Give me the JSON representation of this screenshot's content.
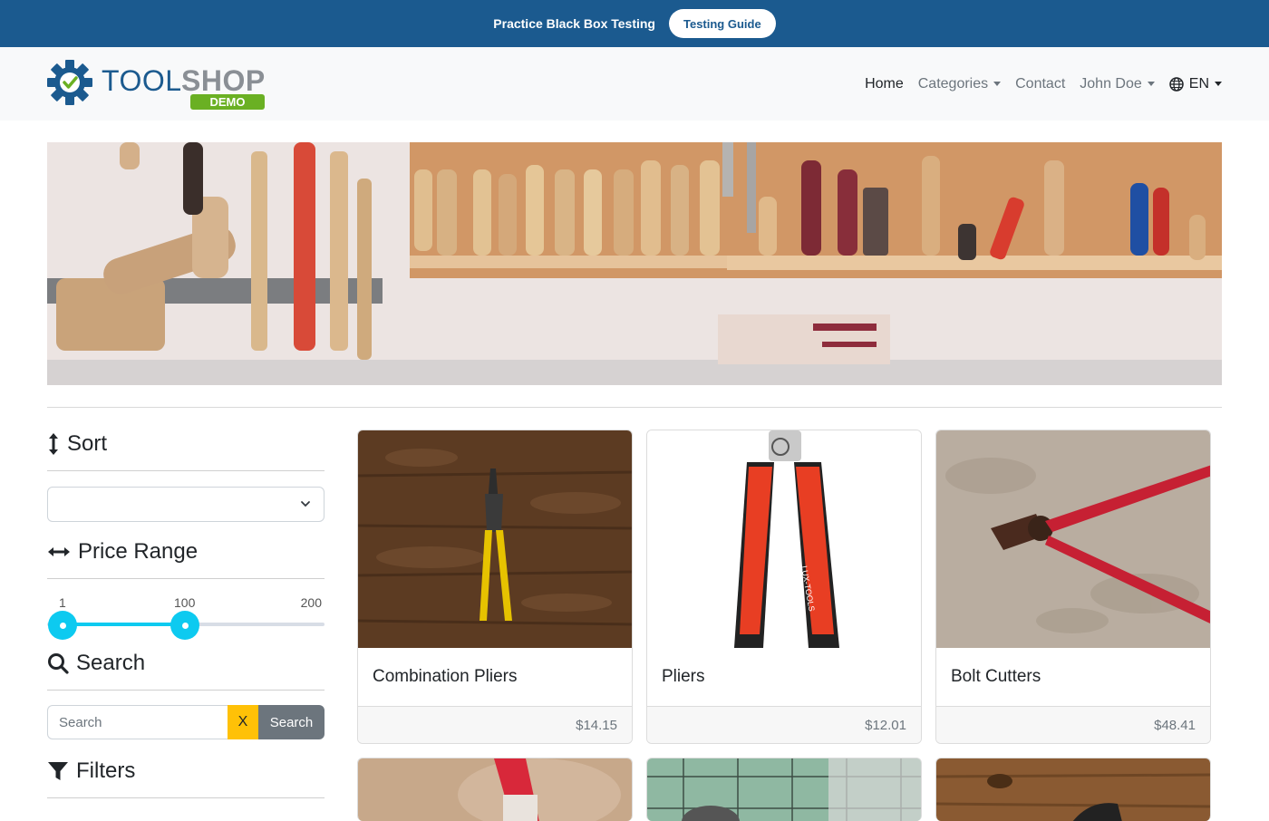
{
  "banner": {
    "text": "Practice Black Box Testing",
    "guide_button": "Testing Guide"
  },
  "logo": {
    "brand": "TOOLSHOP",
    "tag": "DEMO"
  },
  "nav": {
    "home": "Home",
    "categories": "Categories",
    "contact": "Contact",
    "user": "John Doe",
    "language": "EN"
  },
  "sidebar": {
    "sort_heading": "Sort",
    "sort_value": "",
    "price_heading": "Price Range",
    "price_min_label": "1",
    "price_current_label": "100",
    "price_max_label": "200",
    "price_range": {
      "min": 1,
      "max": 200,
      "low": 1,
      "high": 100
    },
    "search_heading": "Search",
    "search_placeholder": "Search",
    "clear_label": "X",
    "search_button": "Search",
    "filters_heading": "Filters"
  },
  "products": [
    {
      "name": "Combination Pliers",
      "price": "$14.15"
    },
    {
      "name": "Pliers",
      "price": "$12.01"
    },
    {
      "name": "Bolt Cutters",
      "price": "$48.41"
    }
  ],
  "colors": {
    "banner": "#1b5a8f",
    "accent": "#0dcaf0",
    "clear": "#ffc107",
    "logo_green": "#6ab023",
    "logo_blue": "#1b5a8f"
  }
}
